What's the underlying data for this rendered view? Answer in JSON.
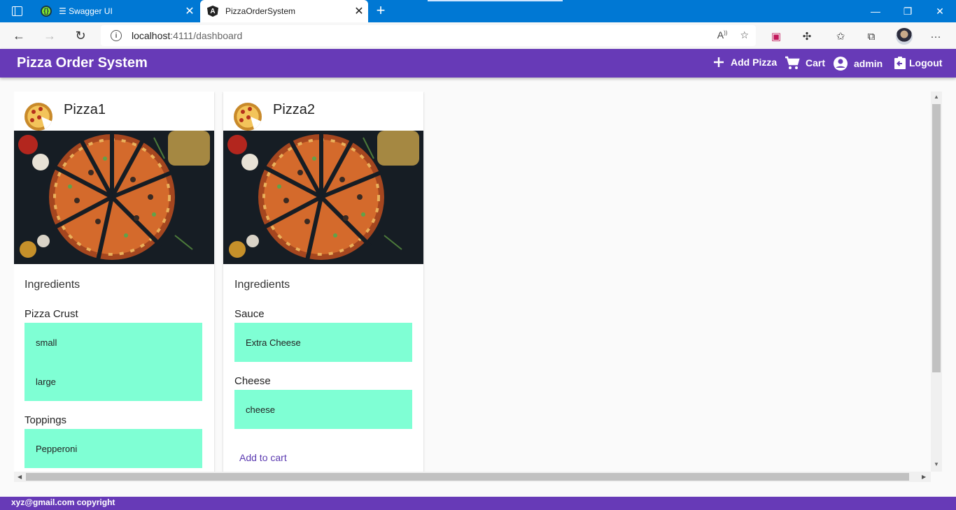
{
  "browser": {
    "tabs": [
      {
        "title": "☰ Swagger UI",
        "active": false
      },
      {
        "title": "PizzaOrderSystem",
        "active": true
      }
    ],
    "url_host": "localhost",
    "url_rest": ":4111/dashboard"
  },
  "app": {
    "title": "Pizza Order System",
    "actions": {
      "add_pizza": "Add Pizza",
      "cart": "Cart",
      "user": "admin",
      "logout": "Logout"
    },
    "accent_color": "#673ab7",
    "option_color": "#7fffd4"
  },
  "cards": [
    {
      "title": "Pizza1",
      "ingredients_label": "Ingredients",
      "groups": [
        {
          "label": "Pizza Crust",
          "options": [
            "small",
            "large"
          ]
        },
        {
          "label": "Toppings",
          "options": [
            "Pepperoni"
          ]
        }
      ]
    },
    {
      "title": "Pizza2",
      "ingredients_label": "Ingredients",
      "groups": [
        {
          "label": "Sauce",
          "options": [
            "Extra Cheese"
          ]
        },
        {
          "label": "Cheese",
          "options": [
            "cheese"
          ]
        }
      ],
      "add_to_cart": "Add to cart"
    }
  ],
  "footer": {
    "text": "xyz@gmail.com copyright"
  }
}
